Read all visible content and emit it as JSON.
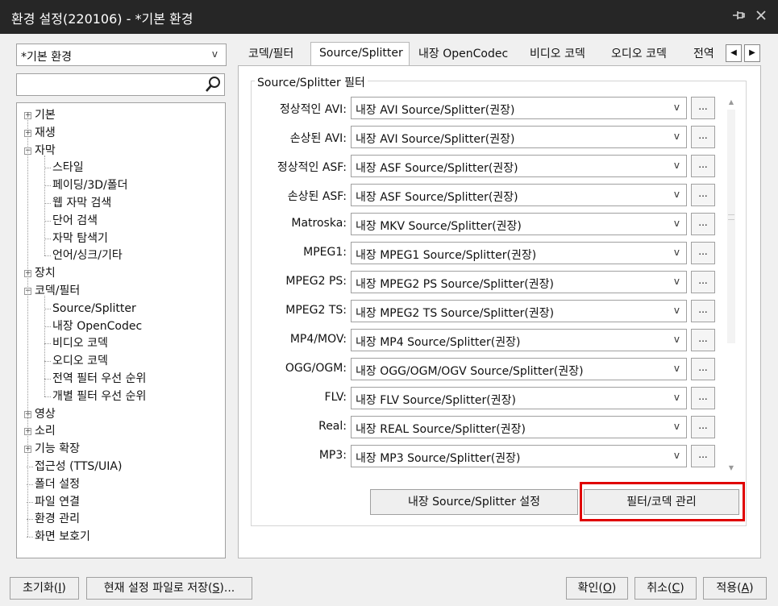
{
  "window": {
    "title": "환경 설정(220106) - *기본 환경",
    "pin_icon": "pin-icon",
    "close_icon": "close-icon"
  },
  "profile_select": {
    "value": "*기본 환경"
  },
  "search": {
    "value": "",
    "icon": "search-icon"
  },
  "tree": [
    {
      "label": "기본",
      "level": 0,
      "expander": "+"
    },
    {
      "label": "재생",
      "level": 0,
      "expander": "+"
    },
    {
      "label": "자막",
      "level": 0,
      "expander": "-"
    },
    {
      "label": "스타일",
      "level": 1
    },
    {
      "label": "페이딩/3D/폴더",
      "level": 1
    },
    {
      "label": "웹 자막 검색",
      "level": 1
    },
    {
      "label": "단어 검색",
      "level": 1
    },
    {
      "label": "자막 탐색기",
      "level": 1
    },
    {
      "label": "언어/싱크/기타",
      "level": 1
    },
    {
      "label": "장치",
      "level": 0,
      "expander": "+"
    },
    {
      "label": "코덱/필터",
      "level": 0,
      "expander": "-"
    },
    {
      "label": "Source/Splitter",
      "level": 1,
      "selected": true
    },
    {
      "label": "내장 OpenCodec",
      "level": 1
    },
    {
      "label": "비디오 코덱",
      "level": 1
    },
    {
      "label": "오디오 코덱",
      "level": 1
    },
    {
      "label": "전역 필터 우선 순위",
      "level": 1
    },
    {
      "label": "개별 필터 우선 순위",
      "level": 1
    },
    {
      "label": "영상",
      "level": 0,
      "expander": "+"
    },
    {
      "label": "소리",
      "level": 0,
      "expander": "+"
    },
    {
      "label": "기능 확장",
      "level": 0,
      "expander": "+"
    },
    {
      "label": "접근성 (TTS/UIA)",
      "level": 0
    },
    {
      "label": "폴더 설정",
      "level": 0
    },
    {
      "label": "파일 연결",
      "level": 0
    },
    {
      "label": "환경 관리",
      "level": 0
    },
    {
      "label": "화면 보호기",
      "level": 0
    }
  ],
  "tabs": [
    {
      "label": "코덱/필터"
    },
    {
      "label": "Source/Splitter",
      "active": true
    },
    {
      "label": "내장 OpenCodec"
    },
    {
      "label": "비디오 코덱"
    },
    {
      "label": "오디오 코덱"
    },
    {
      "label": "전역"
    }
  ],
  "group_title": "Source/Splitter 필터",
  "rows": [
    {
      "label": "정상적인 AVI:",
      "value": "내장 AVI Source/Splitter(권장)"
    },
    {
      "label": "손상된 AVI:",
      "value": "내장 AVI Source/Splitter(권장)"
    },
    {
      "label": "정상적인 ASF:",
      "value": "내장 ASF Source/Splitter(권장)"
    },
    {
      "label": "손상된 ASF:",
      "value": "내장 ASF Source/Splitter(권장)"
    },
    {
      "label": "Matroska:",
      "value": "내장 MKV Source/Splitter(권장)"
    },
    {
      "label": "MPEG1:",
      "value": "내장 MPEG1 Source/Splitter(권장)"
    },
    {
      "label": "MPEG2 PS:",
      "value": "내장 MPEG2 PS Source/Splitter(권장)"
    },
    {
      "label": "MPEG2 TS:",
      "value": "내장 MPEG2 TS Source/Splitter(권장)"
    },
    {
      "label": "MP4/MOV:",
      "value": "내장 MP4 Source/Splitter(권장)"
    },
    {
      "label": "OGG/OGM:",
      "value": "내장 OGG/OGM/OGV Source/Splitter(권장)"
    },
    {
      "label": "FLV:",
      "value": "내장 FLV Source/Splitter(권장)"
    },
    {
      "label": "Real:",
      "value": "내장 REAL Source/Splitter(권장)"
    },
    {
      "label": "MP3:",
      "value": "내장 MP3 Source/Splitter(권장)"
    }
  ],
  "row_button_label": "...",
  "combo_arrow": "v",
  "buttons": {
    "splitter_settings": "내장 Source/Splitter 설정",
    "filter_codec_manage": "필터/코덱 관리"
  },
  "bottom": {
    "reset": {
      "text": "초기화(",
      "key": "I",
      "end": ")"
    },
    "save_file": {
      "text": "현재 설정 파일로 저장(",
      "key": "S",
      "end": ")..."
    },
    "ok": {
      "text": "확인(",
      "key": "O",
      "end": ")"
    },
    "cancel": {
      "text": "취소(",
      "key": "C",
      "end": ")"
    },
    "apply": {
      "text": "적용(",
      "key": "A",
      "end": ")"
    }
  },
  "colors": {
    "highlight": "#e00000",
    "titlebar": "#262626"
  }
}
